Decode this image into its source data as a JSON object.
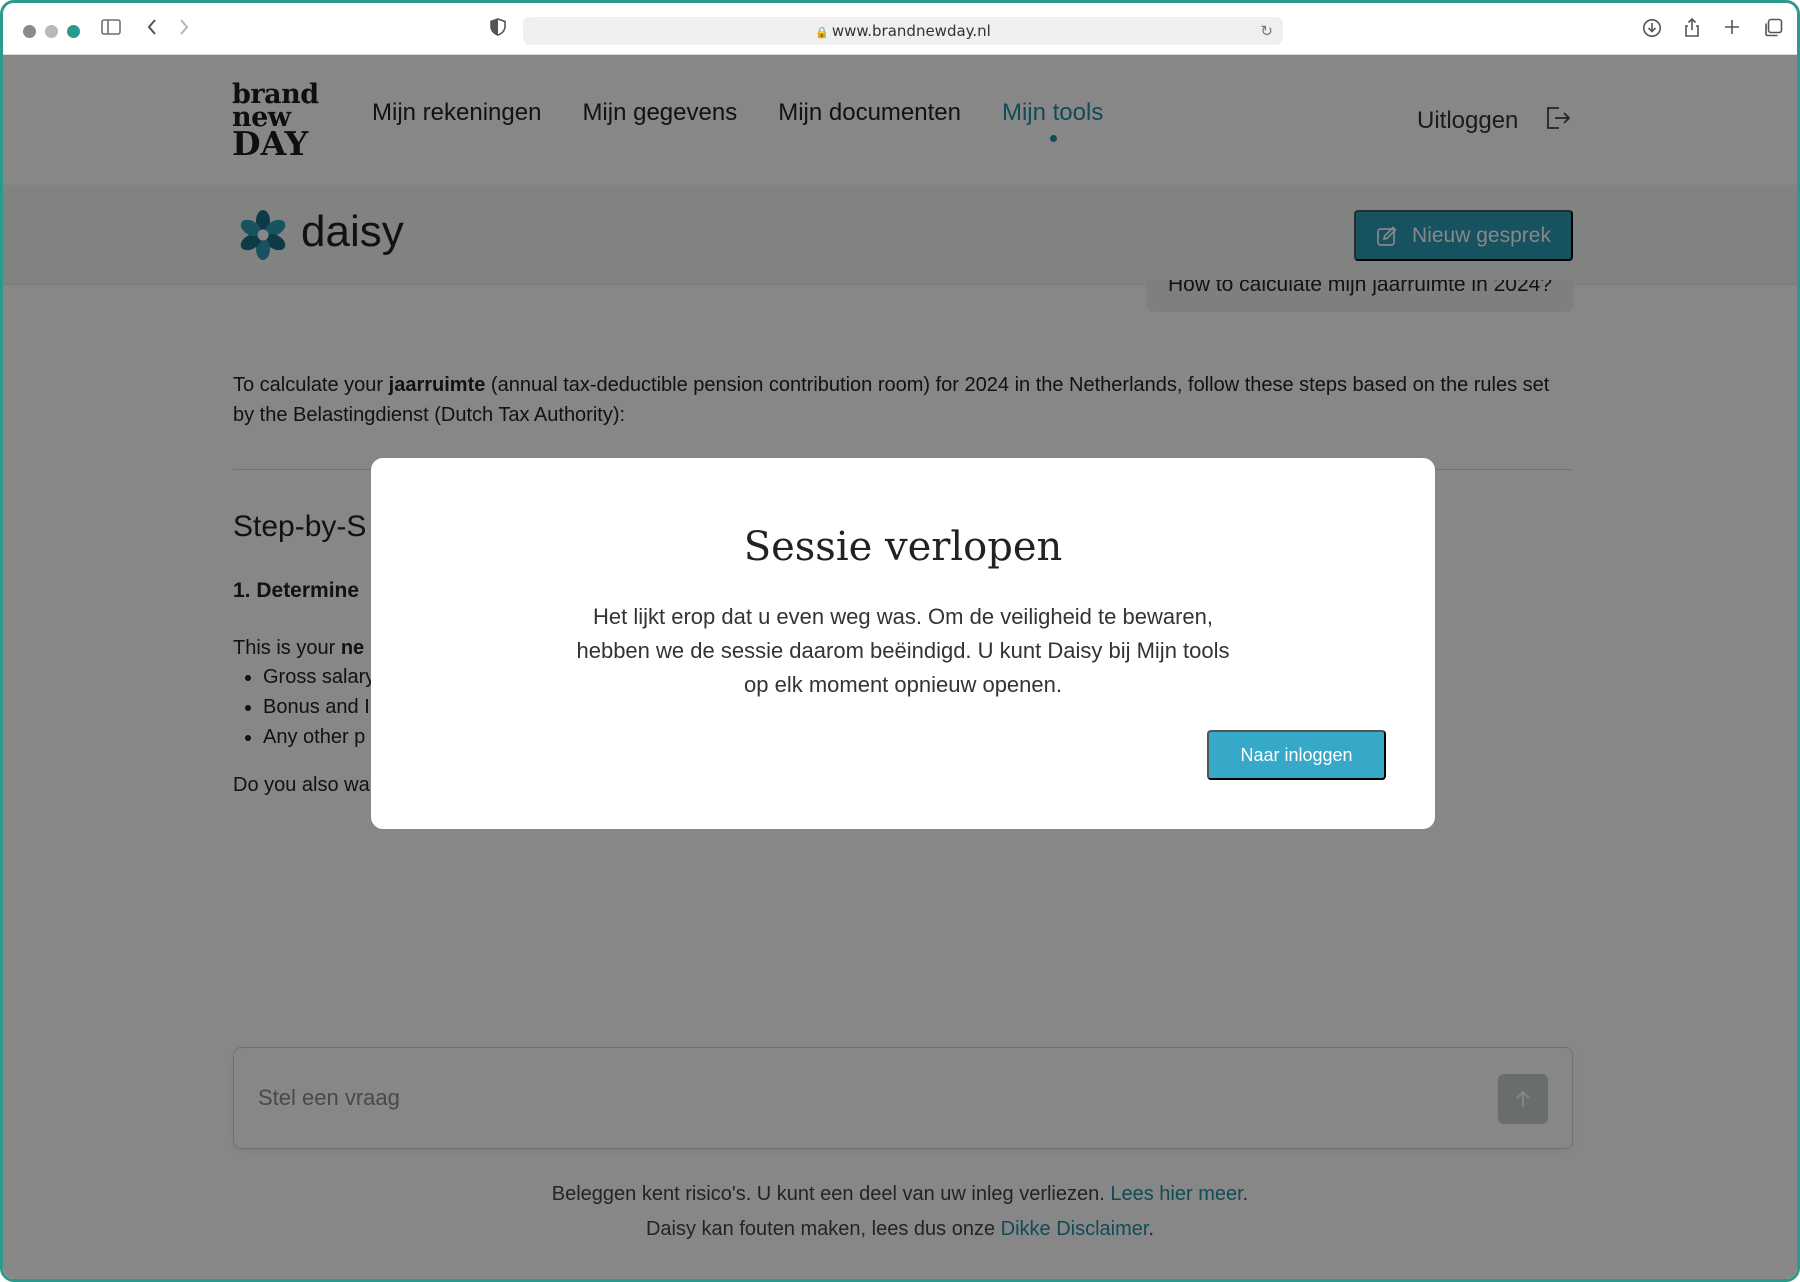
{
  "browser": {
    "url": "www.brandnewday.nl",
    "icons": [
      "sidebar-icon",
      "back-icon",
      "forward-icon",
      "shield-icon",
      "lock-icon",
      "reload-icon",
      "download-icon",
      "share-icon",
      "new-tab-icon",
      "tabs-icon"
    ]
  },
  "header": {
    "logo": {
      "line1": "brand",
      "line2": "new",
      "line3": "DAY"
    },
    "nav": [
      {
        "label": "Mijn rekeningen",
        "active": false
      },
      {
        "label": "Mijn gegevens",
        "active": false
      },
      {
        "label": "Mijn documenten",
        "active": false
      },
      {
        "label": "Mijn tools",
        "active": true
      }
    ],
    "logout_label": "Uitloggen"
  },
  "daisy": {
    "name": "daisy",
    "new_chat_label": "Nieuw gesprek"
  },
  "conversation": {
    "user_question": "How to calculate mijn jaarruimte in 2024?",
    "intro_pre": "To calculate your ",
    "intro_bold": "jaarruimte",
    "intro_post": " (annual tax-deductible pension contribution room) for 2024 in the Netherlands, follow these steps based on the rules set by the Belastingdienst (Dutch Tax Authority):",
    "step_heading": "Step-by-S",
    "sub_heading": "1. Determine",
    "para2_pre": "This is your ",
    "para2_bold": "ne",
    "bullets": [
      "Gross salary",
      "Bonus and I",
      "Any other p"
    ],
    "para3": "Do you also wa mobile app?"
  },
  "input": {
    "placeholder": "Stel een vraag"
  },
  "footer": {
    "line1_text": "Beleggen kent risico's. U kunt een deel van uw inleg verliezen. ",
    "line1_link": "Lees hier meer",
    "line1_end": ".",
    "line2_text": "Daisy kan fouten maken, lees dus onze ",
    "line2_link": "Dikke Disclaimer",
    "line2_end": "."
  },
  "modal": {
    "title": "Sessie verlopen",
    "body": "Het lijkt erop dat u even weg was. Om de veiligheid te bewaren, hebben we de sessie daarom beëindigd. U kunt Daisy bij Mijn tools op elk moment opnieuw openen.",
    "button_label": "Naar inloggen"
  },
  "colors": {
    "accent": "#1f8ea6",
    "button": "#2a9bb3",
    "modal_button": "#35a9c7",
    "window_border": "#2a9a8c"
  }
}
